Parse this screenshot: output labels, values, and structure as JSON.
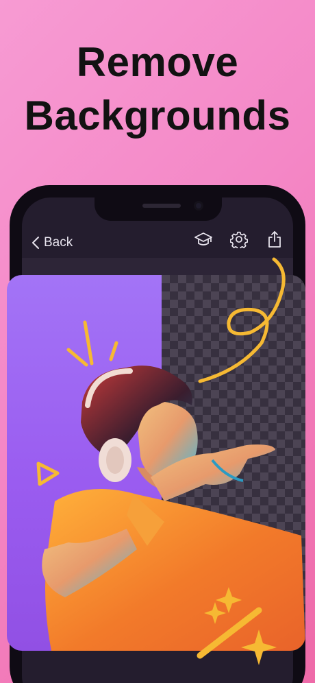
{
  "headline": {
    "line1": "Remove",
    "line2": "Backgrounds"
  },
  "navbar": {
    "back_label": "Back",
    "icons": [
      "tutorial-cap-icon",
      "settings-gear-icon",
      "share-icon"
    ]
  },
  "colors": {
    "background_gradient": [
      "#f79bd3",
      "#ee6aa8"
    ],
    "phone_frame": "#0f0b14",
    "screen_bg": "#241d2e",
    "purple_backdrop": "#9a5cf0",
    "accent_doodles": "#f6b933",
    "shirt": "#f08a2c"
  }
}
